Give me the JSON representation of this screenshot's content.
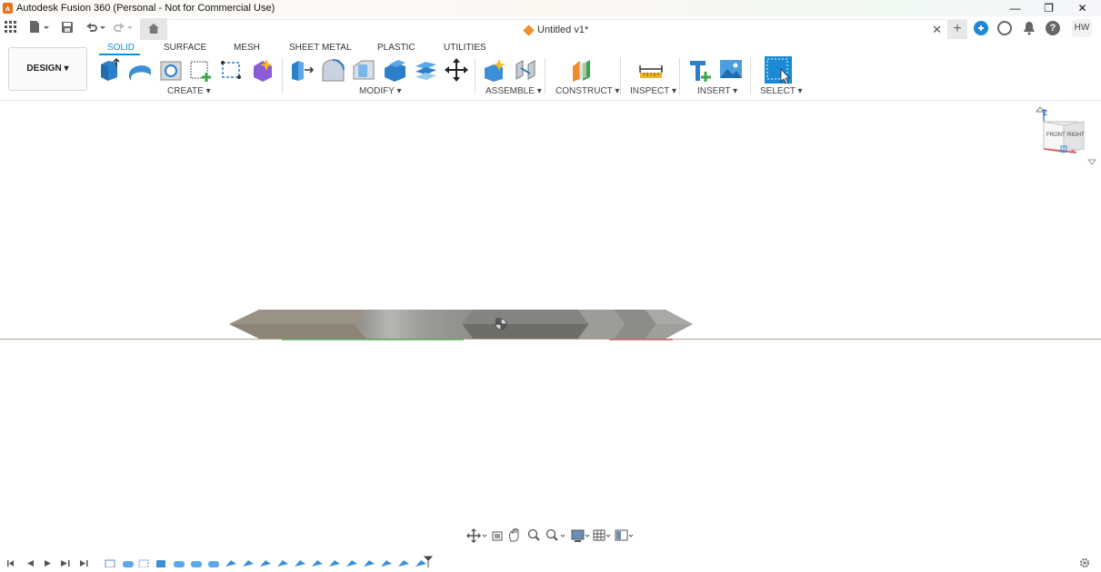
{
  "window": {
    "title": "Autodesk Fusion 360 (Personal - Not for Commercial Use)",
    "minimize": "—",
    "maximize": "❐",
    "close": "✕"
  },
  "tabbar": {
    "doc_title": "Untitled v1*",
    "close_tab": "✕",
    "new_tab": "+",
    "user_initials": "HW"
  },
  "workspace": {
    "label": "DESIGN ▾"
  },
  "ribbon_tabs": [
    "SOLID",
    "SURFACE",
    "MESH",
    "SHEET METAL",
    "PLASTIC",
    "UTILITIES"
  ],
  "ribbon_groups": {
    "create": "CREATE ▾",
    "modify": "MODIFY ▾",
    "assemble": "ASSEMBLE ▾",
    "construct": "CONSTRUCT ▾",
    "inspect": "INSPECT ▾",
    "insert": "INSERT ▾",
    "select": "SELECT ▾"
  },
  "viewcube": {
    "front": "FRONT",
    "right": "RIGHT",
    "z": "Z",
    "x": "X"
  },
  "colors": {
    "accent": "#0696d7",
    "brand": "#e8731d",
    "ground": "#b3a68e"
  }
}
